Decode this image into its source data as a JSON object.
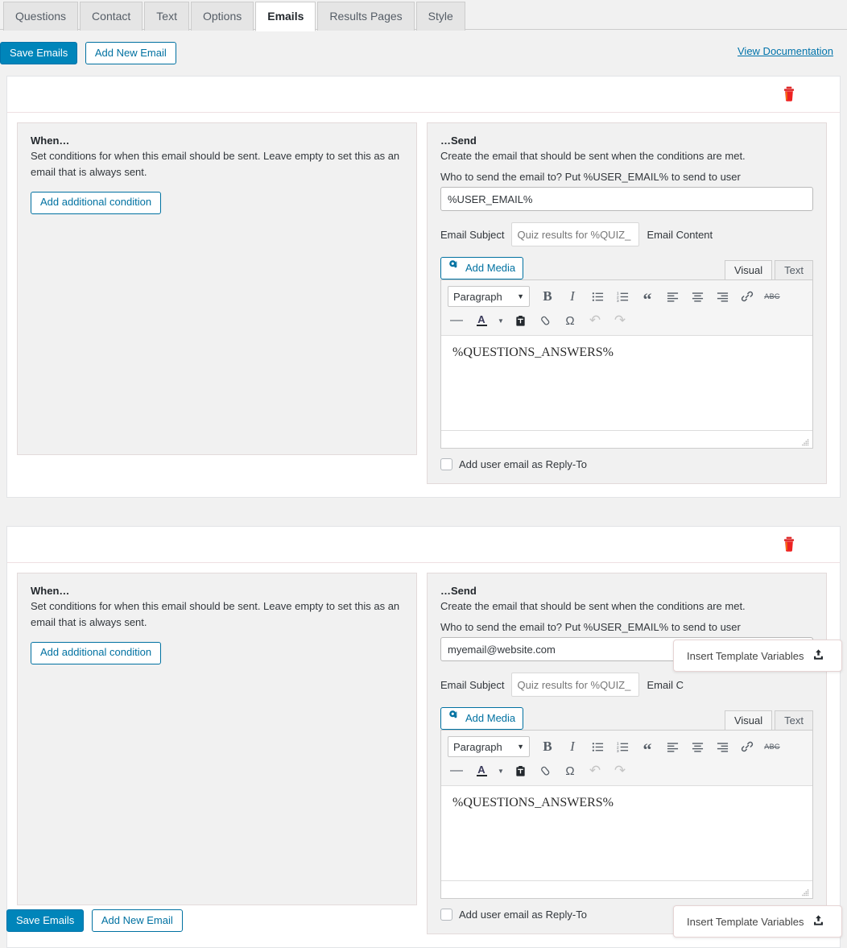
{
  "tabs": [
    {
      "label": "Questions",
      "active": false
    },
    {
      "label": "Contact",
      "active": false
    },
    {
      "label": "Text",
      "active": false
    },
    {
      "label": "Options",
      "active": false
    },
    {
      "label": "Emails",
      "active": true
    },
    {
      "label": "Results Pages",
      "active": false
    },
    {
      "label": "Style",
      "active": false
    }
  ],
  "toolbar": {
    "save_label": "Save Emails",
    "add_new_label": "Add New Email",
    "doc_link": "View Documentation"
  },
  "colors": {
    "primary": "#0085ba",
    "link": "#0073aa",
    "danger": "#dd2222",
    "page_bg": "#f1f1f1",
    "panel_bg": "#f1f1f1"
  },
  "icons": {
    "trash": "trash-icon",
    "add_media": "media-icon",
    "upload": "upload-icon"
  },
  "editor_toolbar": {
    "format_value": "Paragraph",
    "row1": [
      {
        "name": "bold-icon",
        "glyph": "B"
      },
      {
        "name": "italic-icon",
        "glyph": "I"
      },
      {
        "name": "bulleted-list-icon",
        "glyph": "☰"
      },
      {
        "name": "numbered-list-icon",
        "glyph": "☰"
      },
      {
        "name": "blockquote-icon",
        "glyph": "“"
      },
      {
        "name": "align-left-icon",
        "glyph": "≡"
      },
      {
        "name": "align-center-icon",
        "glyph": "≡"
      },
      {
        "name": "align-right-icon",
        "glyph": "≡"
      },
      {
        "name": "link-icon",
        "glyph": "🔗"
      },
      {
        "name": "strikethrough-icon",
        "glyph": "ABC"
      }
    ],
    "row2": [
      {
        "name": "horizontal-rule-icon",
        "glyph": "—"
      },
      {
        "name": "text-color-icon",
        "glyph": "A"
      },
      {
        "name": "paste-as-text-icon",
        "glyph": "📋"
      },
      {
        "name": "clear-formatting-icon",
        "glyph": "⬭"
      },
      {
        "name": "special-character-icon",
        "glyph": "Ω"
      },
      {
        "name": "undo-icon",
        "glyph": "↶"
      },
      {
        "name": "redo-icon",
        "glyph": "↷"
      }
    ]
  },
  "emails": [
    {
      "when": {
        "title": "When…",
        "description": "Set conditions for when this email should be sent. Leave empty to set this as an email that is always sent.",
        "add_condition_label": "Add additional condition"
      },
      "send": {
        "title": "…Send",
        "description": "Create the email that should be sent when the conditions are met.",
        "recipient_label": "Who to send the email to? Put %USER_EMAIL% to send to user",
        "recipient_value": "%USER_EMAIL%",
        "recipient_placeholder": "",
        "subject_label": "Email Subject",
        "subject_value": "",
        "subject_placeholder": "Quiz results for %QUIZ_",
        "content_label": "Email Content",
        "add_media_label": "Add Media",
        "editor_tabs": [
          {
            "label": "Visual",
            "active": true
          },
          {
            "label": "Text",
            "active": false
          }
        ],
        "content_value": "%QUESTIONS_ANSWERS%",
        "reply_to_label": "Add user email as Reply-To",
        "reply_to_checked": false
      }
    },
    {
      "when": {
        "title": "When…",
        "description": "Set conditions for when this email should be sent. Leave empty to set this as an email that is always sent.",
        "add_condition_label": "Add additional condition"
      },
      "send": {
        "title": "…Send",
        "description": "Create the email that should be sent when the conditions are met.",
        "recipient_label": "Who to send the email to? Put %USER_EMAIL% to send to user",
        "recipient_value": "myemail@website.com",
        "recipient_placeholder": "",
        "subject_label": "Email Subject",
        "subject_value": "",
        "subject_placeholder": "Quiz results for %QUIZ_",
        "content_label": "Email C",
        "add_media_label": "Add Media",
        "editor_tabs": [
          {
            "label": "Visual",
            "active": true
          },
          {
            "label": "Text",
            "active": false
          }
        ],
        "content_value": "%QUESTIONS_ANSWERS%",
        "reply_to_label": "Add user email as Reply-To",
        "reply_to_checked": false
      }
    }
  ],
  "insert_template_variables": {
    "label": "Insert Template Variables"
  },
  "footer": {
    "save_label": "Save Emails",
    "add_new_label": "Add New Email"
  }
}
